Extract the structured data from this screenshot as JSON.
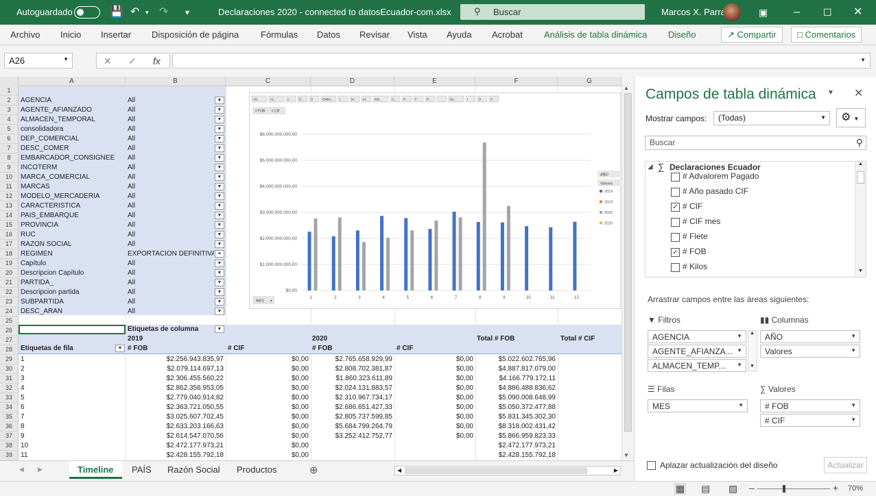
{
  "titlebar": {
    "autosave_label": "Autoguardado",
    "doc_title": "Declaraciones 2020 - connected to datosEcuador-com.xlsx",
    "search_label": "Buscar",
    "user_name": "Marcos X. Parra"
  },
  "ribbon": {
    "tabs": [
      "Archivo",
      "Inicio",
      "Insertar",
      "Disposición de página",
      "Fórmulas",
      "Datos",
      "Revisar",
      "Vista",
      "Ayuda",
      "Acrobat",
      "Análisis de tabla dinámica",
      "Diseño"
    ],
    "share_label": "Compartir",
    "comments_label": "Comentarios"
  },
  "formula_bar": {
    "name_box": "A26",
    "fx": "fx",
    "formula": ""
  },
  "columns": [
    "A",
    "B",
    "C",
    "D",
    "E",
    "F",
    "G"
  ],
  "rows": [
    "1",
    "2",
    "3",
    "4",
    "5",
    "6",
    "7",
    "8",
    "9",
    "10",
    "11",
    "12",
    "13",
    "14",
    "15",
    "16",
    "17",
    "18",
    "19",
    "20",
    "21",
    "22",
    "23",
    "24",
    "25",
    "26",
    "27",
    "28",
    "29",
    "30",
    "31",
    "32",
    "33",
    "34",
    "35",
    "36",
    "37",
    "38",
    "39"
  ],
  "filters": [
    {
      "name": "AGENCIA",
      "value": "All"
    },
    {
      "name": "AGENTE_AFIANZADO",
      "value": "All"
    },
    {
      "name": "ALMACEN_TEMPORAL",
      "value": "All"
    },
    {
      "name": "consolidadora",
      "value": "All"
    },
    {
      "name": "DEP_COMERCIAL",
      "value": "All"
    },
    {
      "name": "DESC_COMER",
      "value": "All"
    },
    {
      "name": "EMBARCADOR_CONSIGNEE",
      "value": "All"
    },
    {
      "name": "INCOTERM",
      "value": "All"
    },
    {
      "name": "MARCA_COMERCIAL",
      "value": "All"
    },
    {
      "name": "MARCAS",
      "value": "All"
    },
    {
      "name": "MODELO_MERCADERIA",
      "value": "All"
    },
    {
      "name": "CARACTERISTICA",
      "value": "All"
    },
    {
      "name": "PAIS_EMBARQUE",
      "value": "All"
    },
    {
      "name": "PROVINCIA",
      "value": "All"
    },
    {
      "name": "RUC",
      "value": "All"
    },
    {
      "name": "RAZON SOCIAL",
      "value": "All"
    },
    {
      "name": "REGIMEN",
      "value": "EXPORTACION DEFINITIVA"
    },
    {
      "name": "Capítulo",
      "value": "All"
    },
    {
      "name": "Descripcion Capítulo",
      "value": "All"
    },
    {
      "name": "PARTIDA_",
      "value": "All"
    },
    {
      "name": "Descripcion partida",
      "value": "All"
    },
    {
      "name": "SUBPARTIDA",
      "value": "All"
    },
    {
      "name": "DESC_ARAN",
      "value": "All"
    }
  ],
  "pivot": {
    "col_labels": "Etiquetas de columna",
    "year1": "2019",
    "year2": "2020",
    "total_fob": "Total # FOB",
    "total_cif": "Total # CIF",
    "row_labels": "Etiquetas de fila",
    "fob": "# FOB",
    "cif": "# CIF",
    "rows": [
      {
        "label": "1",
        "fob19": "$2.256.943.835,97",
        "cif19": "$0,00",
        "fob20": "$2.765.658.929,99",
        "cif20": "$0,00",
        "total": "$5.022.602.765,96"
      },
      {
        "label": "2",
        "fob19": "$2.079.114.697,13",
        "cif19": "$0,00",
        "fob20": "$2.808.702.381,87",
        "cif20": "$0,00",
        "total": "$4.887.817.079,00"
      },
      {
        "label": "3",
        "fob19": "$2.306.455.560,22",
        "cif19": "$0,00",
        "fob20": "$1.860.323.611,89",
        "cif20": "$0,00",
        "total": "$4.166.779.172,11"
      },
      {
        "label": "4",
        "fob19": "$2.862.356.953,05",
        "cif19": "$0,00",
        "fob20": "$2.024.131.883,57",
        "cif20": "$0,00",
        "total": "$4.886.488.836,62"
      },
      {
        "label": "5",
        "fob19": "$2.779.040.914,82",
        "cif19": "$0,00",
        "fob20": "$2.310.967.734,17",
        "cif20": "$0,00",
        "total": "$5.090.008.648,99"
      },
      {
        "label": "6",
        "fob19": "$2.363.721.050,55",
        "cif19": "$0,00",
        "fob20": "$2.686.651.427,33",
        "cif20": "$0,00",
        "total": "$5.050.372.477,88"
      },
      {
        "label": "7",
        "fob19": "$3.025.607.702,45",
        "cif19": "$0,00",
        "fob20": "$2.805.737.599,85",
        "cif20": "$0,00",
        "total": "$5.831.345.302,30"
      },
      {
        "label": "8",
        "fob19": "$2.633.203.166,63",
        "cif19": "$0,00",
        "fob20": "$5.684.799.264,79",
        "cif20": "$0,00",
        "total": "$8.318.002.431,42"
      },
      {
        "label": "9",
        "fob19": "$2.614.547.070,56",
        "cif19": "$0,00",
        "fob20": "$3.252.412.752,77",
        "cif20": "$0,00",
        "total": "$5.866.959.823,33"
      },
      {
        "label": "10",
        "fob19": "$2.472.177.973,21",
        "cif19": "$0,00",
        "fob20": "",
        "cif20": "",
        "total": "$2.472.177.973,21"
      },
      {
        "label": "11",
        "fob19": "$2.428.155.792,18",
        "cif19": "$0,00",
        "fob20": "",
        "cif20": "",
        "total": "$2.428.155.792,18"
      }
    ]
  },
  "chart_data": {
    "type": "bar",
    "categories": [
      "1",
      "2",
      "3",
      "4",
      "5",
      "6",
      "7",
      "8",
      "9",
      "10",
      "11",
      "12"
    ],
    "series": [
      {
        "name": "2019",
        "color": "#4472c4",
        "values": [
          2256943835.97,
          2079114697.13,
          2306455560.22,
          2862356953.05,
          2779040914.82,
          2363721050.55,
          3025607702.45,
          2633203166.63,
          2614547070.56,
          2472177973.21,
          2428155792.18,
          2640000000
        ]
      },
      {
        "name": "2020",
        "color": "#a5a5a5",
        "values": [
          2765658929.99,
          2808702381.87,
          1860323611.89,
          2024131883.57,
          2310967734.17,
          2686651427.33,
          2805737599.85,
          5684799264.79,
          3252412752.77,
          null,
          null,
          null
        ]
      }
    ],
    "ylim": [
      0,
      6000000000
    ],
    "y_ticks": [
      "$0,00",
      "$1.000.000.000,00",
      "$2.000.000.000,00",
      "$3.000.000.000,00",
      "$4.000.000.000,00",
      "$5.000.000.000,00",
      "$6.000.000.000,00"
    ],
    "field_buttons": [
      "AG..",
      "AL..",
      "c..",
      "D..",
      "D",
      "EMBA..",
      "I",
      "M..",
      "M..",
      "MO..",
      "C..",
      "P..",
      "F",
      "R..",
      "",
      "De..",
      "I",
      "D",
      "S"
    ],
    "value_buttons": [
      "# FOB",
      "# CIF"
    ],
    "axis_button": "MES",
    "legend_title": "AÑO",
    "legend_sub": "Valores",
    "legend": [
      {
        "label": "2019",
        "color": "#4472c4"
      },
      {
        "label": "2019",
        "color": "#ed7d31"
      },
      {
        "label": "2020",
        "color": "#a5a5a5"
      },
      {
        "label": "2020",
        "color": "#ffc000"
      }
    ],
    "grid": true
  },
  "sheets": [
    "Timeline",
    "PAÍS",
    "Razón Social",
    "Productos"
  ],
  "pane": {
    "title": "Campos de tabla dinámica",
    "show_fields_label": "Mostrar campos:",
    "show_fields_value": "(Todas)",
    "search_placeholder": "Buscar",
    "table_name": "Declaraciones Ecuador",
    "fields": [
      {
        "label": "# Advalorem Pagado",
        "checked": false
      },
      {
        "label": "# Año pasado CIF",
        "checked": false
      },
      {
        "label": "# CIF",
        "checked": true
      },
      {
        "label": "# CIF mes",
        "checked": false
      },
      {
        "label": "# Flete",
        "checked": false
      },
      {
        "label": "# FOB",
        "checked": true
      },
      {
        "label": "# Kilos",
        "checked": false
      }
    ],
    "drag_label": "Arrastrar campos entre las áreas siguientes:",
    "filters_label": "Filtros",
    "columns_label": "Columnas",
    "rows_label": "Filas",
    "values_label": "Valores",
    "filter_items": [
      "AGENCIA",
      "AGENTE_AFIANZA...",
      "ALMACEN_TEMP..."
    ],
    "column_items": [
      "AÑO",
      "Valores"
    ],
    "row_items": [
      "MES"
    ],
    "value_items": [
      "# FOB",
      "# CIF"
    ],
    "defer_label": "Aplazar actualización del diseño",
    "update_label": "Actualizar"
  },
  "status": {
    "zoom": "70%"
  }
}
